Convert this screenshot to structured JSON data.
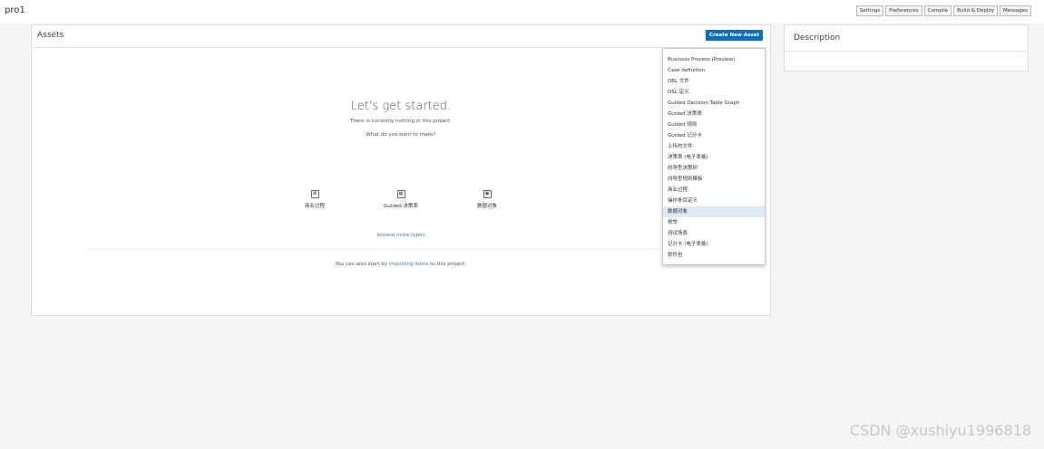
{
  "header": {
    "project": "pro1",
    "buttons": [
      "Settings",
      "Preferences",
      "Compile",
      "Build & Deploy",
      "Messages"
    ]
  },
  "assets": {
    "title": "Assets",
    "create_button": "Create New Asset",
    "empty": {
      "title": "Let's get started.",
      "subtitle": "There is currently nothing in this project.",
      "question": "What do you want to make?"
    },
    "quick_create": [
      {
        "label": "商业过程",
        "icon": "business-process-icon"
      },
      {
        "label": "Guided 决策表",
        "icon": "decision-table-icon"
      },
      {
        "label": "数据对象",
        "icon": "data-object-icon"
      }
    ],
    "browse_more": "browse more types",
    "import_prefix": "You can also start by ",
    "import_link": "importing items",
    "import_suffix": " to this project."
  },
  "description": {
    "title": "Description"
  },
  "dropdown": {
    "items": [
      "Business Process (Preview)",
      "Case definition",
      "DRL 文件",
      "DSL 定义",
      "Guided Decision Table Graph",
      "Guided 决策表",
      "Guided 规则",
      "Guided 记分卡",
      "上传的文件",
      "决策表 (电子表格)",
      "向导型决策树",
      "向导型规则模板",
      "商业过程",
      "操作条目定义",
      "数据对象",
      "枚举",
      "测试场景",
      "记分卡 (电子表格)",
      "软件包"
    ],
    "highlighted": "数据对象"
  },
  "watermark": "CSDN @xushiyu1996818"
}
